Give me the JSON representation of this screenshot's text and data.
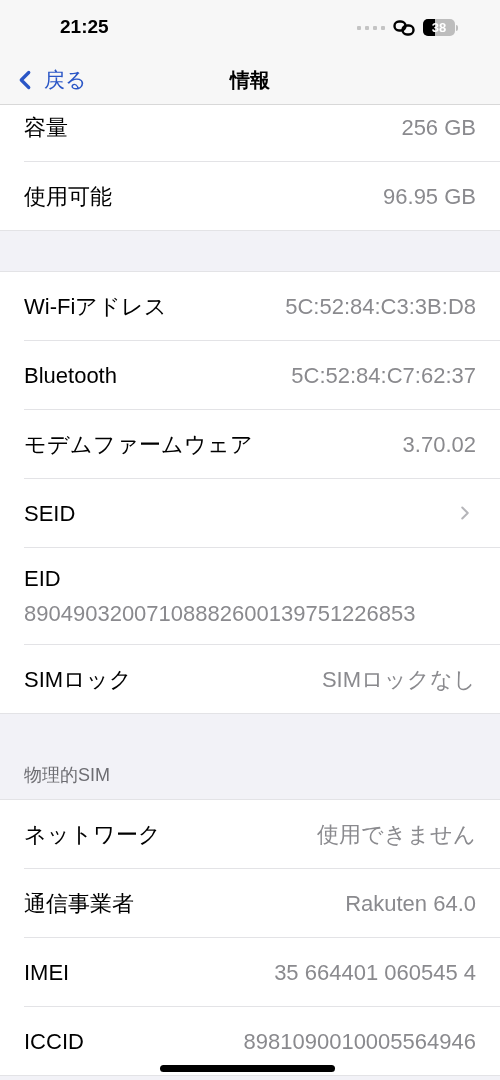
{
  "status_bar": {
    "time": "21:25",
    "battery": "38"
  },
  "nav": {
    "back": "戻る",
    "title": "情報"
  },
  "sections": [
    {
      "rows": [
        {
          "kind": "value",
          "label": "容量",
          "value": "256 GB"
        },
        {
          "kind": "value",
          "label": "使用可能",
          "value": "96.95 GB"
        }
      ]
    },
    {
      "rows": [
        {
          "kind": "value",
          "label": "Wi-Fiアドレス",
          "value": "5C:52:84:C3:3B:D8"
        },
        {
          "kind": "value",
          "label": "Bluetooth",
          "value": "5C:52:84:C7:62:37"
        },
        {
          "kind": "value",
          "label": "モデムファームウェア",
          "value": "3.70.02"
        },
        {
          "kind": "chevron",
          "label": "SEID"
        },
        {
          "kind": "multiline",
          "label": "EID",
          "value": "89049032007108882600139751226853"
        },
        {
          "kind": "value",
          "label": "SIMロック",
          "value": "SIMロックなし"
        }
      ]
    },
    {
      "header": "物理的SIM",
      "rows": [
        {
          "kind": "value",
          "label": "ネットワーク",
          "value": "使用できません"
        },
        {
          "kind": "value",
          "label": "通信事業者",
          "value": "Rakuten 64.0"
        },
        {
          "kind": "value",
          "label": "IMEI",
          "value": "35 664401 060545 4"
        },
        {
          "kind": "value",
          "label": "ICCID",
          "value": "8981090010005564946"
        }
      ]
    }
  ]
}
